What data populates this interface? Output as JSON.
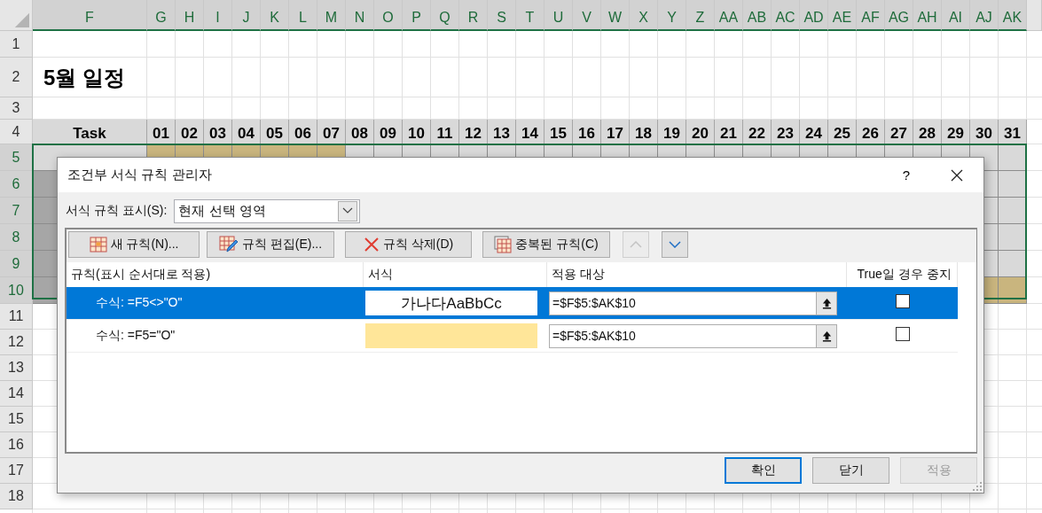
{
  "sheet": {
    "columns": [
      {
        "label": "F",
        "selected": true
      },
      {
        "label": "G",
        "selected": true
      },
      {
        "label": "H",
        "selected": true
      },
      {
        "label": "I",
        "selected": true
      },
      {
        "label": "J",
        "selected": true
      },
      {
        "label": "K",
        "selected": true
      },
      {
        "label": "L",
        "selected": true
      },
      {
        "label": "M",
        "selected": true
      },
      {
        "label": "N",
        "selected": true
      },
      {
        "label": "O",
        "selected": true
      },
      {
        "label": "P",
        "selected": true
      },
      {
        "label": "Q",
        "selected": true
      },
      {
        "label": "R",
        "selected": true
      },
      {
        "label": "S",
        "selected": true
      },
      {
        "label": "T",
        "selected": true
      },
      {
        "label": "U",
        "selected": true
      },
      {
        "label": "V",
        "selected": true
      },
      {
        "label": "W",
        "selected": true
      },
      {
        "label": "X",
        "selected": true
      },
      {
        "label": "Y",
        "selected": true
      },
      {
        "label": "Z",
        "selected": true
      },
      {
        "label": "AA",
        "selected": true
      },
      {
        "label": "AB",
        "selected": true
      },
      {
        "label": "AC",
        "selected": true
      },
      {
        "label": "AD",
        "selected": true
      },
      {
        "label": "AE",
        "selected": true
      },
      {
        "label": "AF",
        "selected": true
      },
      {
        "label": "AG",
        "selected": true
      },
      {
        "label": "AH",
        "selected": true
      },
      {
        "label": "AI",
        "selected": true
      },
      {
        "label": "AJ",
        "selected": true
      },
      {
        "label": "AK",
        "selected": true
      }
    ],
    "rows": [
      {
        "number": "1",
        "selected": false
      },
      {
        "number": "2",
        "selected": false
      },
      {
        "number": "3",
        "selected": false
      },
      {
        "number": "4",
        "selected": false
      },
      {
        "number": "5",
        "selected": true
      },
      {
        "number": "6",
        "selected": true
      },
      {
        "number": "7",
        "selected": true
      },
      {
        "number": "8",
        "selected": true
      },
      {
        "number": "9",
        "selected": true
      },
      {
        "number": "10",
        "selected": true
      },
      {
        "number": "11",
        "selected": false
      },
      {
        "number": "12",
        "selected": false
      },
      {
        "number": "13",
        "selected": false
      },
      {
        "number": "14",
        "selected": false
      },
      {
        "number": "15",
        "selected": false
      },
      {
        "number": "16",
        "selected": false
      },
      {
        "number": "17",
        "selected": false
      },
      {
        "number": "18",
        "selected": false
      }
    ],
    "title": "5월 일정",
    "header": {
      "task": "Task",
      "days": [
        "01",
        "02",
        "03",
        "04",
        "05",
        "06",
        "07",
        "08",
        "09",
        "10",
        "11",
        "12",
        "13",
        "14",
        "15",
        "16",
        "17",
        "18",
        "19",
        "20",
        "21",
        "22",
        "23",
        "24",
        "25",
        "26",
        "27",
        "28",
        "29",
        "30",
        "31"
      ]
    },
    "tasks": [
      {
        "kind": "light",
        "filled": [
          true,
          true,
          true,
          true,
          true,
          true,
          true,
          false,
          false,
          false,
          false,
          false,
          false,
          false,
          false,
          false,
          false,
          false,
          false,
          false,
          false,
          false,
          false,
          false,
          false,
          false,
          false,
          false,
          false,
          false,
          false
        ]
      },
      {
        "kind": "dark",
        "trailing": [
          false,
          false
        ]
      },
      {
        "kind": "dark",
        "trailing": [
          false,
          false
        ]
      },
      {
        "kind": "dark",
        "trailing": [
          false,
          false
        ]
      },
      {
        "kind": "dark",
        "trailing": [
          false,
          false
        ]
      },
      {
        "kind": "dark",
        "trailing": [
          true,
          true
        ]
      }
    ]
  },
  "dialog": {
    "title": "조건부 서식 규칙 관리자",
    "help": "?",
    "show_rules_label": "서식 규칙 표시(S):",
    "show_rules_value": "현재 선택 영역",
    "toolbar": [
      {
        "kind": "new",
        "label": "새 규칙(N)...",
        "disabled": false
      },
      {
        "kind": "edit",
        "label": "규칙 편집(E)...",
        "disabled": false
      },
      {
        "kind": "delete",
        "label": "규칙 삭제(D)",
        "disabled": false
      },
      {
        "kind": "duplicate",
        "label": "중복된 규칙(C)",
        "disabled": false
      },
      {
        "kind": "up",
        "disabled": true
      },
      {
        "kind": "down",
        "disabled": false
      }
    ],
    "columns": [
      "규칙(표시 순서대로 적용)",
      "서식",
      "적용 대상",
      "True일 경우 중지"
    ],
    "rules": [
      {
        "selected": true,
        "rule": "수식: =F5<>\"O\"",
        "preview": "가나다AaBbCc",
        "color": "#ffffff",
        "applies_to": "=$F$5:$AK$10",
        "stop_if_true": false
      },
      {
        "selected": false,
        "rule": "수식: =F5=\"O\"",
        "color": "#ffe699",
        "applies_to": "=$F$5:$AK$10",
        "stop_if_true": false
      }
    ],
    "buttons": [
      {
        "label": "확인",
        "default": true,
        "disabled": false
      },
      {
        "label": "닫기",
        "default": false,
        "disabled": false
      },
      {
        "label": "적용",
        "default": false,
        "disabled": true
      }
    ]
  }
}
